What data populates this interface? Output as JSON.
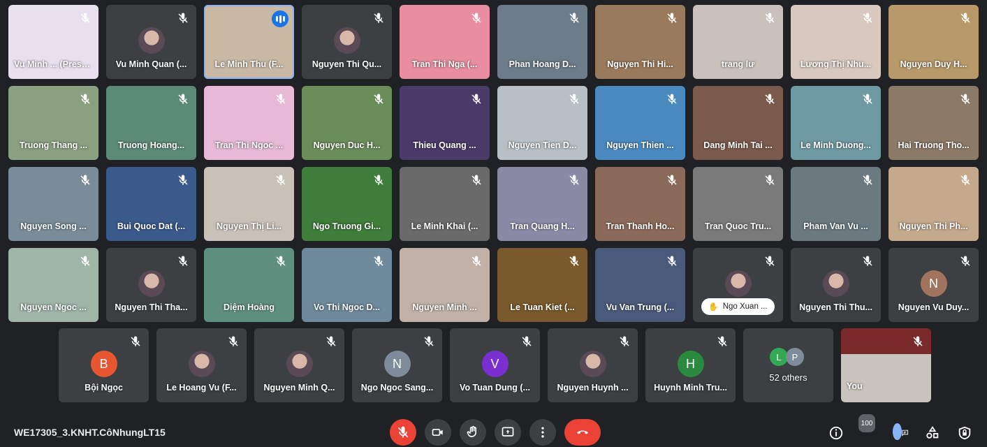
{
  "colors": {
    "background": "#202124",
    "tile": "#3c4043",
    "accent": "#8ab4f8",
    "danger": "#ea4335"
  },
  "rows": [
    [
      {
        "name": "Vu Minh ... (Presentin",
        "bg": "#e8e0ef",
        "icon": "mic-off-icon"
      },
      {
        "name": "Vu Minh Quan (...",
        "bg": "#3c4043",
        "avatar": "photo"
      },
      {
        "name": "Le Minh Thu (F...",
        "bg": "#c9b9a4",
        "active": true
      },
      {
        "name": "Nguyen Thi Qu...",
        "bg": "#3c4043",
        "avatar": "photo"
      },
      {
        "name": "Tran Thi Nga (...",
        "bg": "#e88ea0"
      },
      {
        "name": "Phan Hoang D...",
        "bg": "#6d7c8a"
      },
      {
        "name": "Nguyen Thi Hi...",
        "bg": "#9a7a5c"
      },
      {
        "name": "trang lư",
        "bg": "#c9c2bb"
      },
      {
        "name": "Lương Thị Nhu...",
        "bg": "#d7c9bd"
      },
      {
        "name": "Nguyen Duy H...",
        "bg": "#b89a6a"
      }
    ],
    [
      {
        "name": "Truong Thang ...",
        "bg": "#8aa080"
      },
      {
        "name": "Truong Hoang...",
        "bg": "#5c8a78"
      },
      {
        "name": "Tran Thi Ngoc ...",
        "bg": "#e7b9d6"
      },
      {
        "name": "Nguyen Duc H...",
        "bg": "#6b8d5a"
      },
      {
        "name": "Thieu Quang ...",
        "bg": "#4a3a6a"
      },
      {
        "name": "Nguyen Tien D...",
        "bg": "#b8c0c6"
      },
      {
        "name": "Nguyen Thien ...",
        "bg": "#4a8abf"
      },
      {
        "name": "Dang Minh Tai ...",
        "bg": "#7a5a4c"
      },
      {
        "name": "Le Minh Duong...",
        "bg": "#6f9aa3"
      },
      {
        "name": "Hai Truong Tho...",
        "bg": "#8c7a68"
      }
    ],
    [
      {
        "name": "Nguyen Song ...",
        "bg": "#7a8c99"
      },
      {
        "name": "Bui Quoc Dat (...",
        "bg": "#3a5a8c"
      },
      {
        "name": "Nguyen Thị Li...",
        "bg": "#c9c0b8"
      },
      {
        "name": "Ngo Truong Gi...",
        "bg": "#3e7d3a"
      },
      {
        "name": "Le Minh Khai (...",
        "bg": "#6a6a6a"
      },
      {
        "name": "Tran Quang H...",
        "bg": "#8a8aa6"
      },
      {
        "name": "Tran Thanh Ho...",
        "bg": "#8c6a5a"
      },
      {
        "name": "Tran Quoc Tru...",
        "bg": "#7a7a7a"
      },
      {
        "name": "Pham Van Vu ...",
        "bg": "#6a7a80"
      },
      {
        "name": "Nguyen Thi Ph...",
        "bg": "#c4a98c"
      }
    ],
    [
      {
        "name": "Nguyen Ngoc ...",
        "bg": "#9fb5a8"
      },
      {
        "name": "Nguyen Thi Tha...",
        "bg": "#3c4043",
        "avatar": "photo"
      },
      {
        "name": "Diệm Hoàng",
        "bg": "#5f8f7e"
      },
      {
        "name": "Vo Thi Ngoc D...",
        "bg": "#6f8a9c"
      },
      {
        "name": "Nguyen Minh ...",
        "bg": "#c0b2a6"
      },
      {
        "name": "Le Tuan Kiet (...",
        "bg": "#7a5a2c"
      },
      {
        "name": "Vu Van Trung (...",
        "bg": "#4a5a7a"
      },
      {
        "name": "Ngo Xuan ...",
        "bg": "#3c4043",
        "avatar": "photo",
        "hand": true
      },
      {
        "name": "Nguyen Thi Thu...",
        "bg": "#3c4043",
        "avatar": "photo"
      },
      {
        "name": "Nguyen Vu Duy...",
        "bg": "#3c4043",
        "letter": "N",
        "letter_color": "#a0745e"
      }
    ]
  ],
  "last_row": [
    {
      "name": "Bội Ngọc",
      "letter": "B",
      "letter_color": "#e8562f"
    },
    {
      "name": "Le Hoang Vu (F...",
      "avatar": "photo"
    },
    {
      "name": "Nguyen Minh Q...",
      "avatar": "photo"
    },
    {
      "name": "Ngo Ngoc Sang...",
      "letter": "N",
      "letter_color": "#7d8b9a"
    },
    {
      "name": "Vo Tuan Dung (...",
      "letter": "V",
      "letter_color": "#7b2fd2"
    },
    {
      "name": "Nguyen Huynh ...",
      "avatar": "photo"
    },
    {
      "name": "Huynh Minh Tru...",
      "letter": "H",
      "letter_color": "#2a8a3e"
    }
  ],
  "others": {
    "label": "52 others",
    "bubbles": [
      {
        "letter": "L",
        "color": "#34a853"
      },
      {
        "letter": "P",
        "color": "#7d8b9a"
      }
    ]
  },
  "self": {
    "name": "You",
    "bg": "#6a2a2a"
  },
  "bottom": {
    "meeting_code": "WE17305_3.KNHT.CôNhungLT15",
    "participants_count": "100"
  }
}
